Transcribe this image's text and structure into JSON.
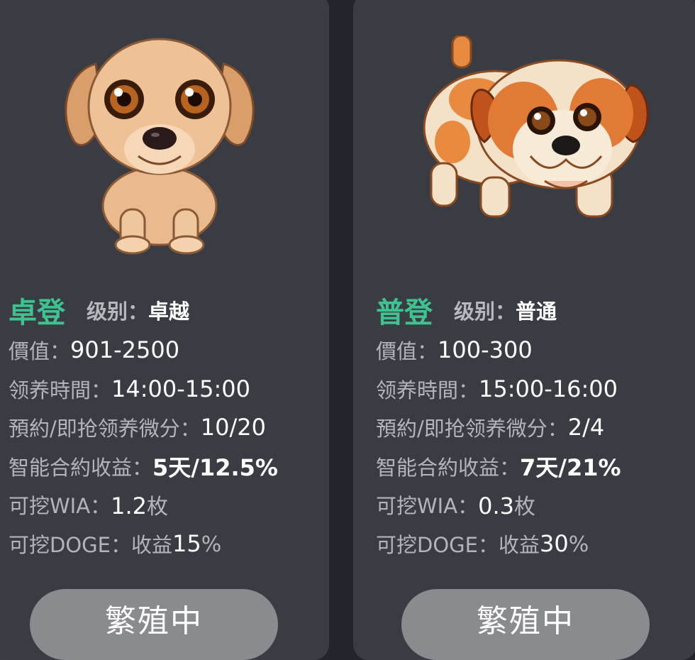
{
  "cards": [
    {
      "name": "卓登",
      "level_label": "级别：",
      "level_value": "卓越",
      "value_label": "價值：",
      "value": "901-2500",
      "time_label": "领养時間：",
      "time": "14:00-15:00",
      "reserve_label": "預約/即抢领养微分：",
      "reserve": "10/20",
      "contract_label": "智能合約收益：",
      "contract": "5天/12.5%",
      "wia_label": "可挖WIA：",
      "wia_value": "1.2",
      "wia_unit": "枚",
      "doge_label": "可挖DOGE：",
      "doge_prefix": "收益",
      "doge_value": "15",
      "doge_unit": "%",
      "button_label": "繁殖中",
      "pet_icon": "puppy-tan-icon"
    },
    {
      "name": "普登",
      "level_label": "级别：",
      "level_value": "普通",
      "value_label": "價值：",
      "value": "100-300",
      "time_label": "领养時間：",
      "time": "15:00-16:00",
      "reserve_label": "預約/即抢领养微分：",
      "reserve": "2/4",
      "contract_label": "智能合約收益：",
      "contract": "7天/21%",
      "wia_label": "可挖WIA：",
      "wia_value": "0.3",
      "wia_unit": "枚",
      "doge_label": "可挖DOGE：",
      "doge_prefix": "收益",
      "doge_value": "30",
      "doge_unit": "%",
      "button_label": "繁殖中",
      "pet_icon": "bulldog-orange-icon"
    }
  ],
  "colors": {
    "background": "#23252c",
    "card": "#3a3c44",
    "accent_name": "#3ec28f",
    "label": "#b4b5ba",
    "value": "#ffffff",
    "button": "#8a8b8f"
  }
}
